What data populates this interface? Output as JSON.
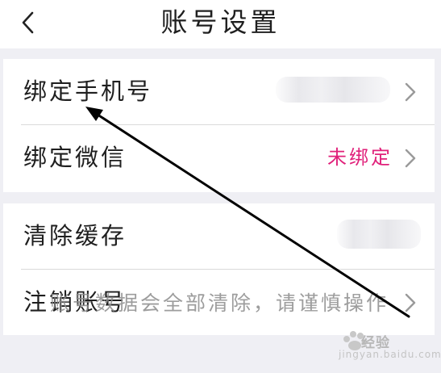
{
  "header": {
    "title": "账号设置",
    "back_icon": "chevron-left-icon"
  },
  "section1": {
    "rows": [
      {
        "label": "绑定手机号",
        "value": ""
      },
      {
        "label": "绑定微信",
        "value": "未绑定"
      }
    ]
  },
  "section2": {
    "rows": [
      {
        "label": "清除缓存",
        "value": ""
      },
      {
        "label": "注销账号",
        "value": ""
      }
    ]
  },
  "toast": "账号数据会全部清除，请谨慎操作",
  "watermark": {
    "text": "经验",
    "sub": "jingyan.baidu.com"
  },
  "colors": {
    "accent": "#e0207a",
    "background": "#efeff4",
    "annotation": "#000000"
  }
}
